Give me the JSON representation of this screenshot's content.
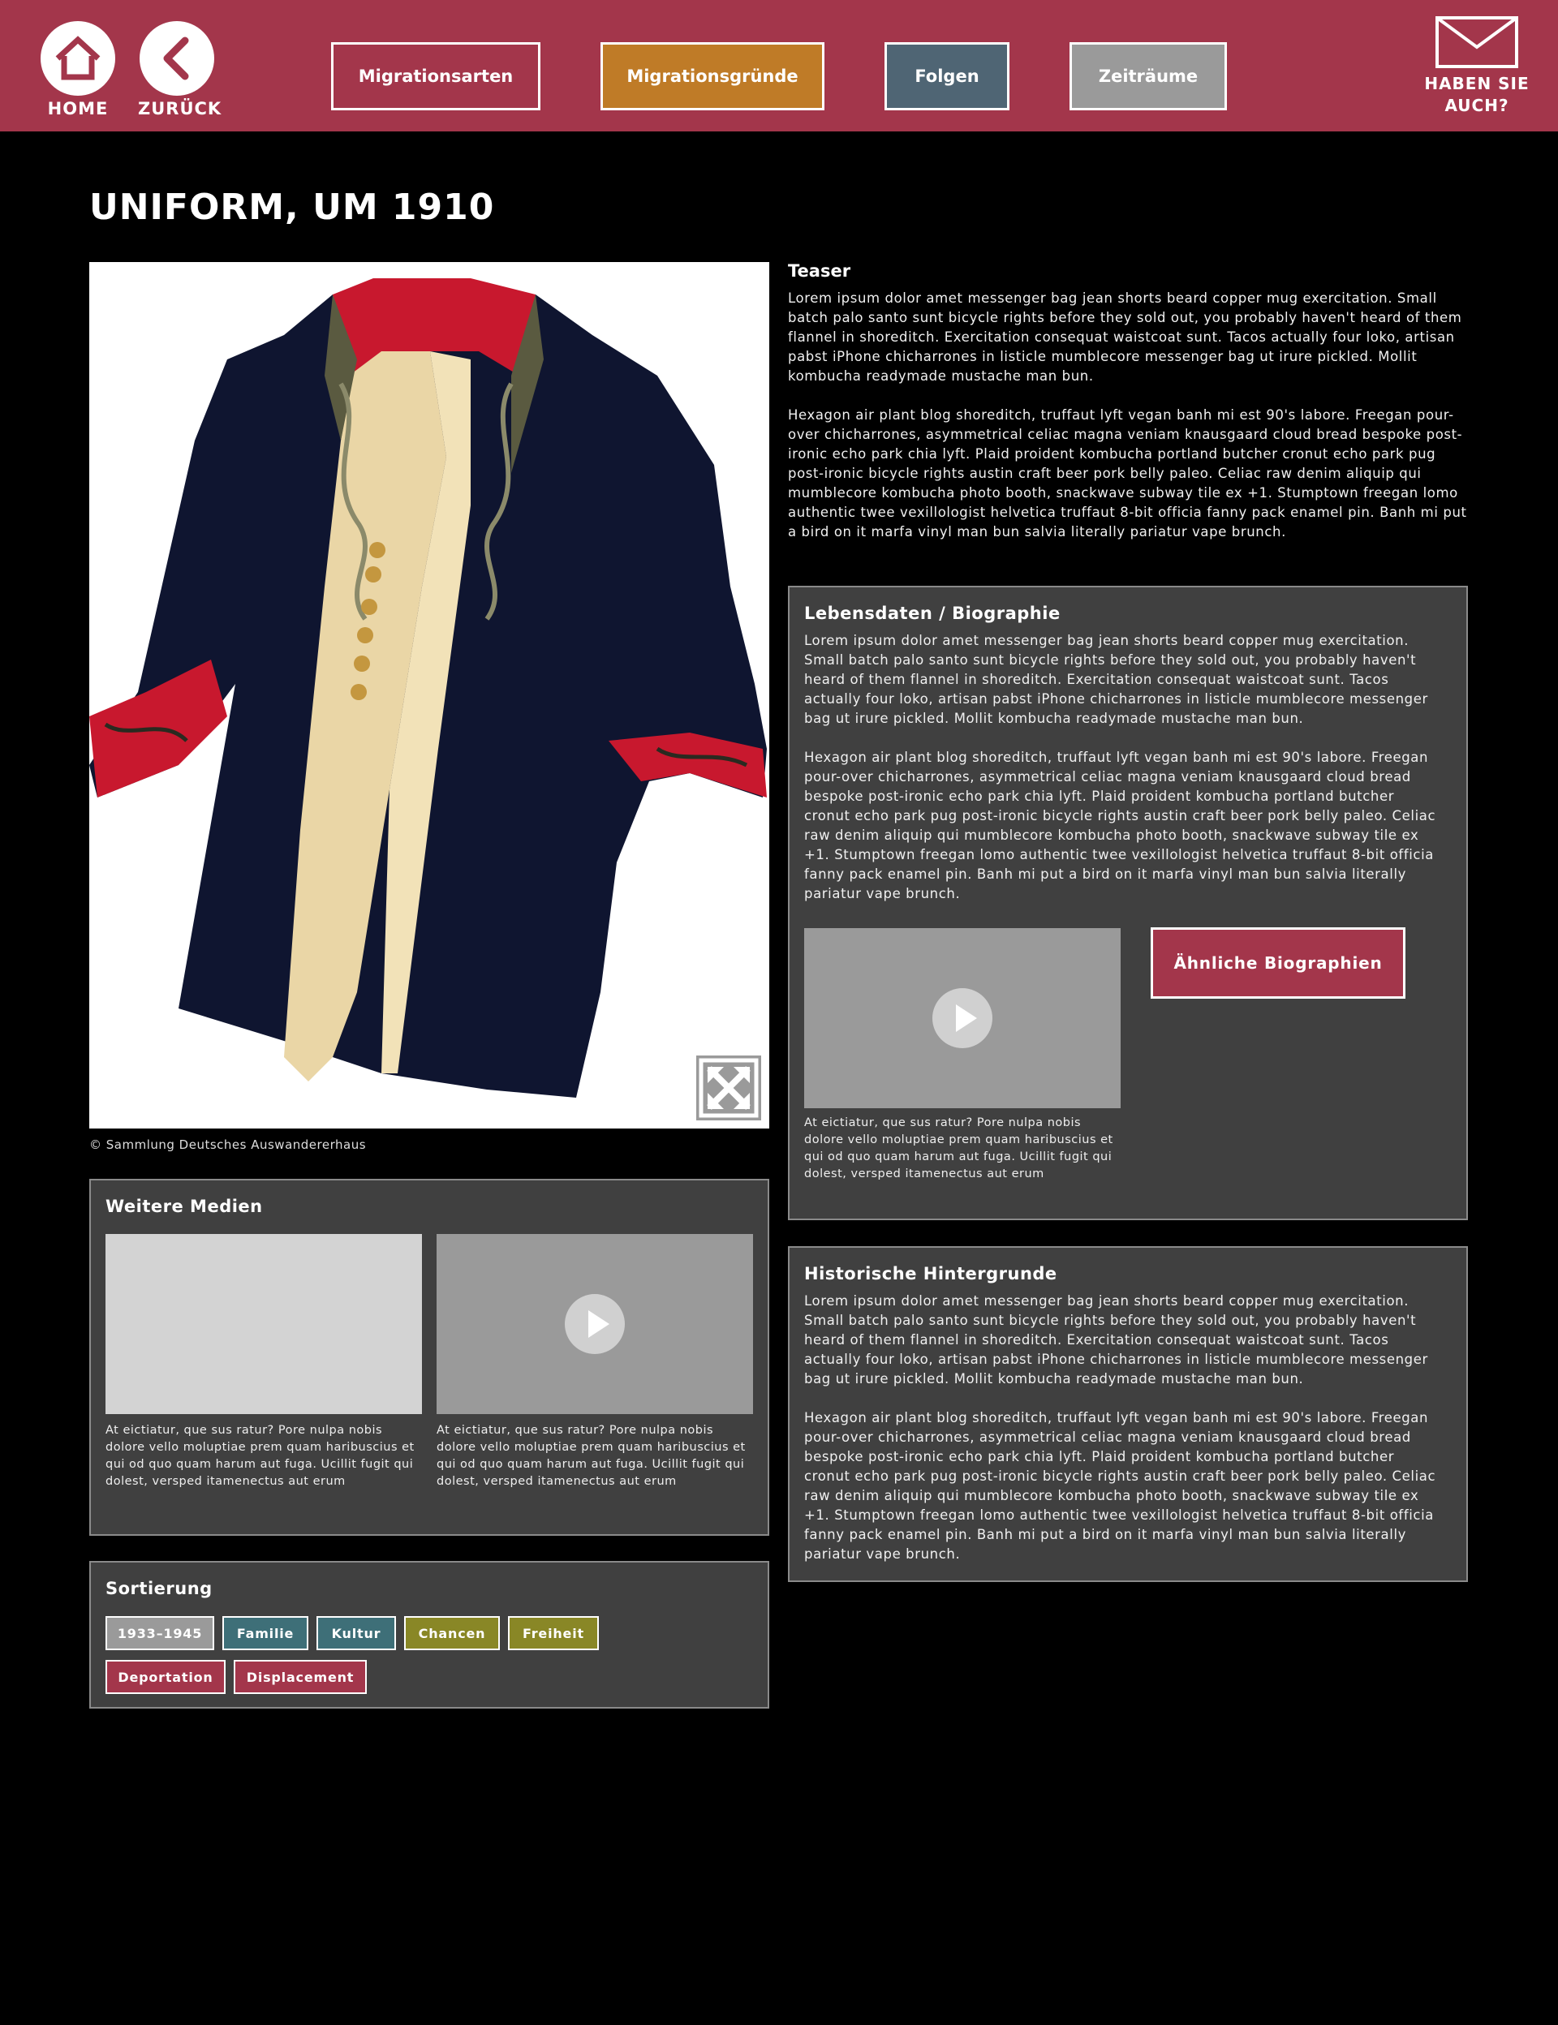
{
  "header": {
    "home_label": "HOME",
    "back_label": "ZURÜCK",
    "tabs": [
      {
        "label": "Migrationsarten",
        "color": "#a3364b"
      },
      {
        "label": "Migrationsgründe",
        "color": "#bf7b27"
      },
      {
        "label": "Folgen",
        "color": "#4f6574"
      },
      {
        "label": "Zeiträume",
        "color": "#9a9a9a"
      }
    ],
    "mail_label_line1": "HABEN SIE",
    "mail_label_line2": "AUCH?"
  },
  "colors": {
    "brand": "#a3364b",
    "panel": "#404040",
    "teal": "#3e6f78",
    "olive": "#898726",
    "gray": "#9a9a9a"
  },
  "page_title": "UNIFORM, UM 1910",
  "image_caption": "© Sammlung Deutsches Auswandererhaus",
  "teaser": {
    "heading": "Teaser",
    "p1": "Lorem ipsum dolor amet messenger bag jean shorts beard copper mug exercitation. Small batch palo santo sunt bicycle rights before they sold out, you probably haven't heard of them flannel in shoreditch. Exercitation consequat waistcoat sunt. Tacos actually four loko, artisan pabst iPhone chicharrones in listicle mumblecore messenger bag ut irure pickled. Mollit kombucha readymade mustache man bun.",
    "p2": "Hexagon air plant blog shoreditch, truffaut lyft vegan banh mi est 90's labore. Freegan pour-over chicharrones, asymmetrical celiac magna veniam knausgaard cloud bread bespoke post-ironic echo park chia lyft. Plaid proident kombucha portland butcher cronut echo park pug post-ironic bicycle rights austin craft beer pork belly paleo. Celiac raw denim aliquip qui mumblecore kombucha photo booth, snackwave subway tile ex +1. Stumptown freegan lomo authentic twee vexillologist helvetica truffaut 8-bit officia fanny pack enamel pin. Banh mi put a bird on it marfa vinyl man bun salvia literally pariatur vape brunch."
  },
  "biography": {
    "heading": "Lebensdaten / Biographie",
    "p1": "Lorem ipsum dolor amet messenger bag jean shorts beard copper mug exercitation. Small batch palo santo sunt bicycle rights before they sold out, you probably haven't heard of them flannel in shoreditch. Exercitation consequat waistcoat sunt. Tacos actually four loko, artisan pabst iPhone chicharrones in listicle mumblecore messenger bag ut irure pickled. Mollit kombucha readymade mustache man bun.",
    "p2": "Hexagon air plant blog shoreditch, truffaut lyft vegan banh mi est 90's labore. Freegan pour-over chicharrones, asymmetrical celiac magna veniam knausgaard cloud bread bespoke post-ironic echo park chia lyft. Plaid proident kombucha portland butcher cronut echo park pug post-ironic bicycle rights austin craft beer pork belly paleo. Celiac raw denim aliquip qui mumblecore kombucha photo booth, snackwave subway tile ex +1. Stumptown freegan lomo authentic twee vexillologist helvetica truffaut 8-bit officia fanny pack enamel pin. Banh mi put a bird on it marfa vinyl man bun salvia literally pariatur vape brunch.",
    "video_caption": "At eictiatur, que sus ratur? Pore nulpa nobis dolore vello moluptiae prem quam haribuscius et qui od quo quam harum aut fuga. Ucillit fugit qui dolest, versped itamenectus aut erum",
    "similar_button": "Ähnliche Biographien"
  },
  "history": {
    "heading": "Historische Hintergrunde",
    "p1": "Lorem ipsum dolor amet messenger bag jean shorts beard copper mug exercitation. Small batch palo santo sunt bicycle rights before they sold out, you probably haven't heard of them flannel in shoreditch. Exercitation consequat waistcoat sunt. Tacos actually four loko, artisan pabst iPhone chicharrones in listicle mumblecore messenger bag ut irure pickled. Mollit kombucha readymade mustache man bun.",
    "p2": "Hexagon air plant blog shoreditch, truffaut lyft vegan banh mi est 90's labore. Freegan pour-over chicharrones, asymmetrical celiac magna veniam knausgaard cloud bread bespoke post-ironic echo park chia lyft. Plaid proident kombucha portland butcher cronut echo park pug post-ironic bicycle rights austin craft beer pork belly paleo. Celiac raw denim aliquip qui mumblecore kombucha photo booth, snackwave subway tile ex +1. Stumptown freegan lomo authentic twee vexillologist helvetica truffaut 8-bit officia fanny pack enamel pin. Banh mi put a bird on it marfa vinyl man bun salvia literally pariatur vape brunch."
  },
  "media": {
    "heading": "Weitere Medien",
    "items": [
      {
        "caption": "At eictiatur, que sus ratur? Pore nulpa nobis dolore vello moluptiae prem quam haribuscius et qui od quo quam harum aut fuga. Ucillit fugit qui dolest, versped itamenectus aut erum"
      },
      {
        "caption": "At eictiatur, que sus ratur? Pore nulpa nobis dolore vello moluptiae prem quam haribuscius et qui od quo quam harum aut fuga. Ucillit fugit qui dolest, versped itamenectus aut erum"
      }
    ]
  },
  "sorting": {
    "heading": "Sortierung",
    "tags": [
      {
        "label": "1933–1945",
        "color": "#9a9a9a"
      },
      {
        "label": "Familie",
        "color": "#3e6f78"
      },
      {
        "label": "Kultur",
        "color": "#3e6f78"
      },
      {
        "label": "Chancen",
        "color": "#898726"
      },
      {
        "label": "Freiheit",
        "color": "#898726"
      },
      {
        "label": "Deportation",
        "color": "#a3364b"
      },
      {
        "label": "Displacement",
        "color": "#a3364b"
      }
    ]
  }
}
